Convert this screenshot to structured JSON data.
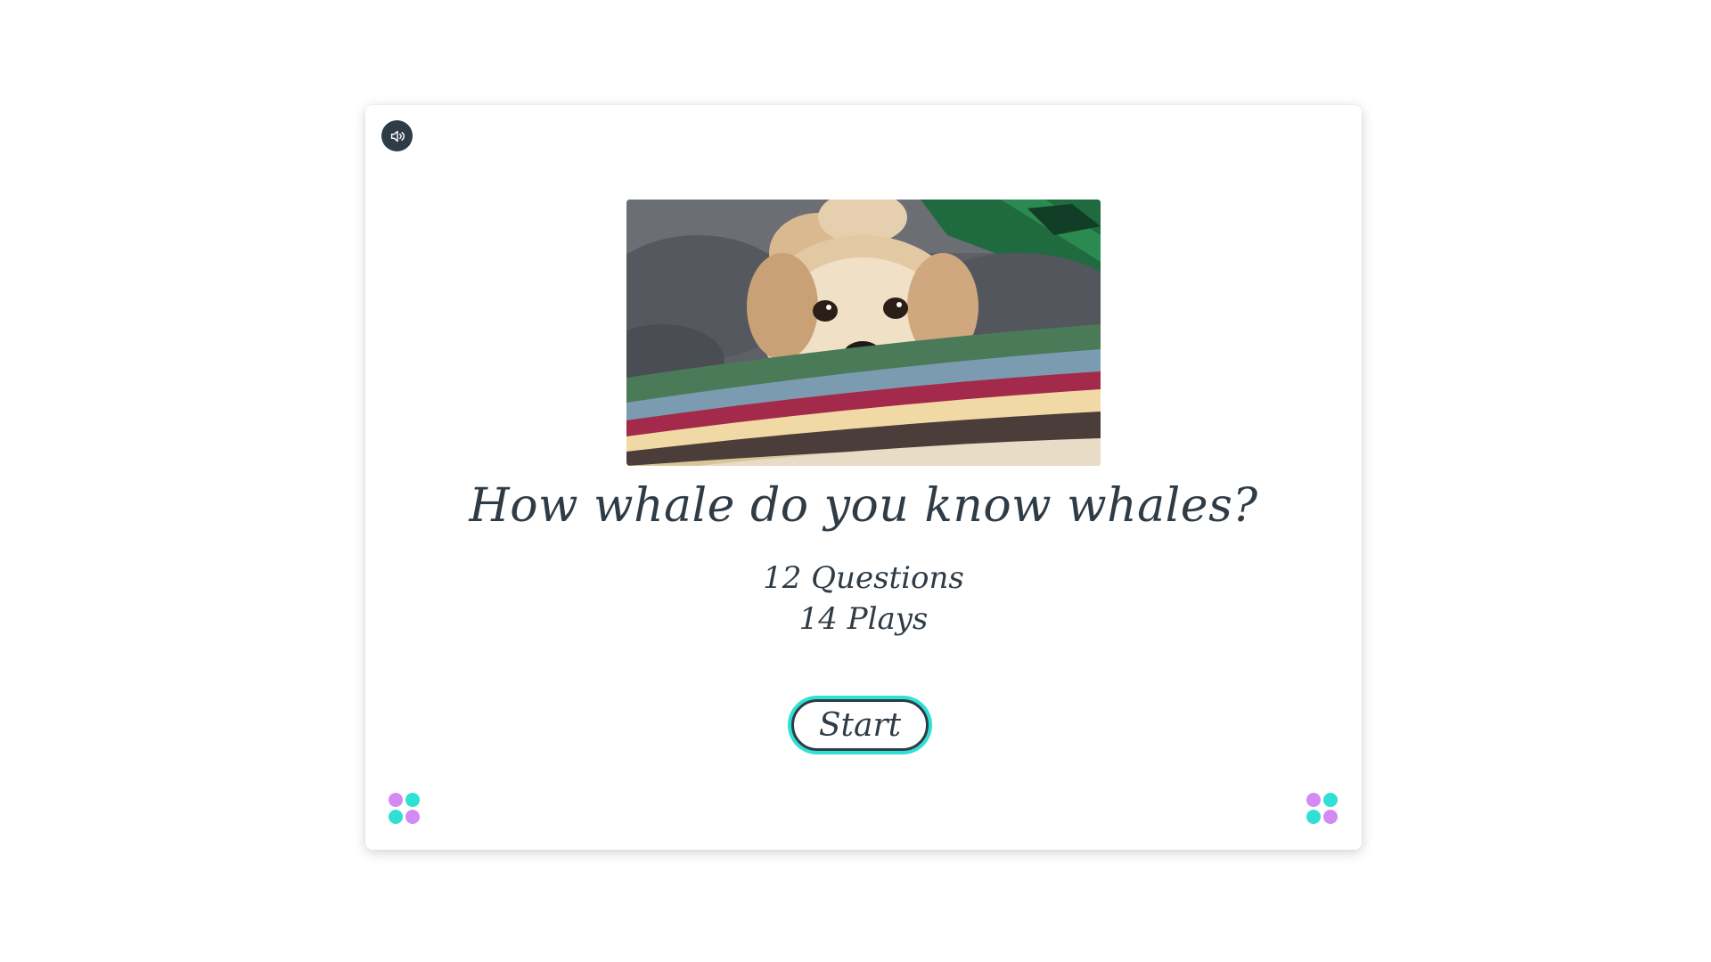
{
  "quiz": {
    "title": "How whale do you know whales?",
    "questions_label": "12 Questions",
    "plays_label": "14 Plays",
    "start_label": "Start"
  },
  "icons": {
    "sound": "speaker-icon",
    "logo": "four-dots-logo-icon"
  },
  "colors": {
    "text": "#2f3b45",
    "accent_cyan": "#2fe0d4",
    "accent_purple": "#d38af5",
    "sound_button_bg": "#2f3b45"
  }
}
